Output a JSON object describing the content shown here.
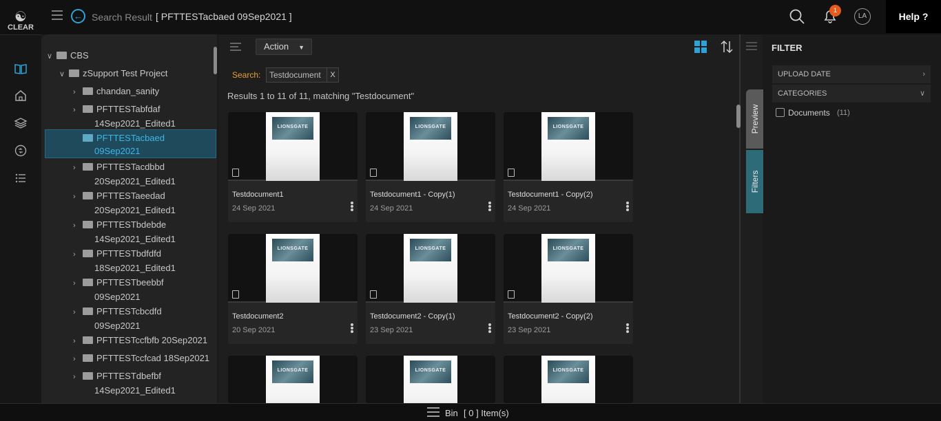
{
  "app": {
    "logo_text": "CLEAR"
  },
  "header": {
    "breadcrumb_label": "Search Result",
    "breadcrumb_value": "[ PFTTESTacbaed 09Sep2021 ]",
    "notification_count": "1",
    "avatar_initials": "LA",
    "help_label": "Help ?"
  },
  "tree": {
    "items": [
      {
        "label": "CBS",
        "level": 0,
        "expanded": true
      },
      {
        "label": "zSupport Test Project",
        "level": 1,
        "expanded": true
      },
      {
        "label": "chandan_sanity",
        "level": 2
      },
      {
        "label": "PFTTESTabfdaf",
        "label2": "14Sep2021_Edited1",
        "level": 2
      },
      {
        "label": "PFTTESTacbaed",
        "label2": "09Sep2021",
        "level": 2,
        "selected": true
      },
      {
        "label": "PFTTESTacdbbd",
        "label2": "20Sep2021_Edited1",
        "level": 2
      },
      {
        "label": "PFTTESTaeedad",
        "label2": "20Sep2021_Edited1",
        "level": 2
      },
      {
        "label": "PFTTESTbdebde",
        "label2": "14Sep2021_Edited1",
        "level": 2
      },
      {
        "label": "PFTTESTbdfdfd",
        "label2": "18Sep2021_Edited1",
        "level": 2
      },
      {
        "label": "PFTTESTbeebbf",
        "label2": "09Sep2021",
        "level": 2
      },
      {
        "label": "PFTTESTcbcdfd",
        "label2": "09Sep2021",
        "level": 2
      },
      {
        "label": "PFTTESTccfbfb 20Sep2021",
        "level": 2
      },
      {
        "label": "PFTTESTccfcad 18Sep2021",
        "level": 2
      },
      {
        "label": "PFTTESTdbefbf",
        "label2": "14Sep2021_Edited1",
        "level": 2
      }
    ]
  },
  "toolbar": {
    "action_label": "Action",
    "search_label": "Search:",
    "search_term": "Testdocument",
    "clear_label": "X",
    "results_text": "Results 1 to 11 of 11, matching \"Testdocument\""
  },
  "thumbnail_text": "LIONSGATE",
  "cards": [
    {
      "title": "Testdocument1",
      "date": "24 Sep 2021"
    },
    {
      "title": "Testdocument1 - Copy(1)",
      "date": "24 Sep 2021"
    },
    {
      "title": "Testdocument1 - Copy(2)",
      "date": "24 Sep 2021"
    },
    {
      "title": "Testdocument2",
      "date": "20 Sep 2021"
    },
    {
      "title": "Testdocument2 - Copy(1)",
      "date": "23 Sep 2021"
    },
    {
      "title": "Testdocument2 - Copy(2)",
      "date": "23 Sep 2021"
    }
  ],
  "side_tabs": {
    "preview": "Preview",
    "filters": "Filters"
  },
  "filter": {
    "title": "FILTER",
    "upload_date": "UPLOAD DATE",
    "categories": "CATEGORIES",
    "category_items": [
      {
        "label": "Documents",
        "count": "(11)"
      }
    ]
  },
  "bin": {
    "label": "Bin",
    "count": "[ 0 ] Item(s)"
  },
  "colors": {
    "accent": "#2fa3d6",
    "selected_bg": "#1e4a5c",
    "search_label": "#e8a030",
    "badge": "#e65a1e",
    "filters_tab": "#2e6b78"
  },
  "icons": [
    "hamburger-icon",
    "back-arrow-icon",
    "search-icon",
    "bell-icon",
    "avatar",
    "book-icon",
    "home-icon",
    "layers-icon",
    "sync-icon",
    "list-icon",
    "grid-view-icon",
    "sort-icon",
    "menu-icon",
    "document-icon",
    "kebab-icon"
  ]
}
